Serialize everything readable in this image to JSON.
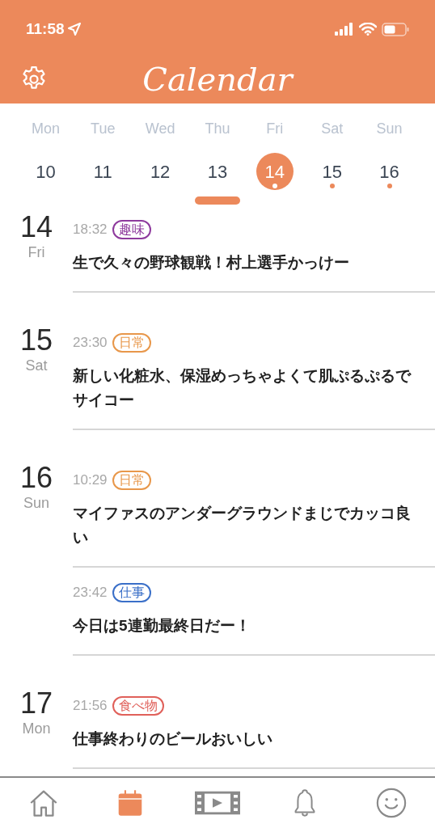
{
  "status_bar": {
    "time": "11:58"
  },
  "header": {
    "title": "Calendar"
  },
  "week": [
    {
      "weekday": "Mon",
      "date": "10",
      "selected": false,
      "has_event": false
    },
    {
      "weekday": "Tue",
      "date": "11",
      "selected": false,
      "has_event": false
    },
    {
      "weekday": "Wed",
      "date": "12",
      "selected": false,
      "has_event": false
    },
    {
      "weekday": "Thu",
      "date": "13",
      "selected": false,
      "has_event": false
    },
    {
      "weekday": "Fri",
      "date": "14",
      "selected": true,
      "has_event": true
    },
    {
      "weekday": "Sat",
      "date": "15",
      "selected": false,
      "has_event": true
    },
    {
      "weekday": "Sun",
      "date": "16",
      "selected": false,
      "has_event": true
    }
  ],
  "days": [
    {
      "date": "14",
      "weekday": "Fri",
      "entries": [
        {
          "time": "18:32",
          "tag": "趣味",
          "color": "#8e3a9d",
          "text": "生で久々の野球観戦！村上選手かっけー"
        }
      ]
    },
    {
      "date": "15",
      "weekday": "Sat",
      "entries": [
        {
          "time": "23:30",
          "tag": "日常",
          "color": "#e8974a",
          "text": "新しい化粧水、保湿めっちゃよくて肌ぷるぷるでサイコー"
        }
      ]
    },
    {
      "date": "16",
      "weekday": "Sun",
      "entries": [
        {
          "time": "10:29",
          "tag": "日常",
          "color": "#e8974a",
          "text": "マイファスのアンダーグラウンドまじでカッコ良い"
        },
        {
          "time": "23:42",
          "tag": "仕事",
          "color": "#3a6fc8",
          "text": "今日は5連勤最終日だー！"
        }
      ]
    },
    {
      "date": "17",
      "weekday": "Mon",
      "entries": [
        {
          "time": "21:56",
          "tag": "食べ物",
          "color": "#e0605a",
          "text": "仕事終わりのビールおいしい"
        }
      ]
    }
  ],
  "tab_bar": [
    {
      "kind": "home",
      "selected": false
    },
    {
      "kind": "calendar",
      "selected": true
    },
    {
      "kind": "video",
      "selected": false
    },
    {
      "kind": "bell",
      "selected": false
    },
    {
      "kind": "smiley",
      "selected": false
    }
  ]
}
